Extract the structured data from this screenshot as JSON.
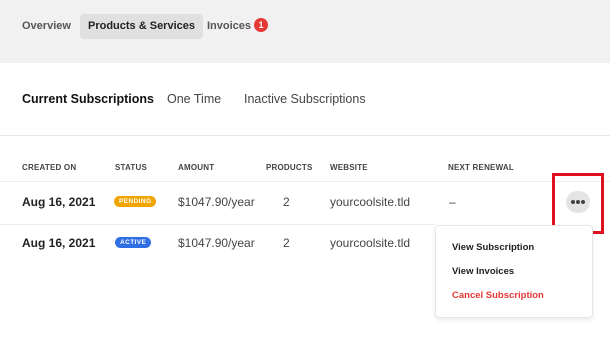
{
  "top_tabs": {
    "overview": "Overview",
    "products": "Products & Services",
    "invoices": "Invoices",
    "invoices_badge": "1"
  },
  "sub_tabs": {
    "current": "Current Subscriptions",
    "one_time": "One Time",
    "inactive": "Inactive Subscriptions"
  },
  "table": {
    "headers": {
      "created_on": "CREATED ON",
      "status": "STATUS",
      "amount": "AMOUNT",
      "products": "PRODUCTS",
      "website": "WEBSITE",
      "next_renewal": "NEXT RENEWAL"
    },
    "rows": [
      {
        "created_on": "Aug 16, 2021",
        "status": "PENDING",
        "status_color": "#f0a500",
        "amount": "$1047.90/year",
        "products": "2",
        "website": "yourcoolsite.tld",
        "next_renewal": "–"
      },
      {
        "created_on": "Aug 16, 2021",
        "status": "ACTIVE",
        "status_color": "#2f6fe4",
        "amount": "$1047.90/year",
        "products": "2",
        "website": "yourcoolsite.tld",
        "next_renewal": ""
      }
    ]
  },
  "row_actions": {
    "more_icon": "more-horizontal-icon",
    "menu": {
      "view_subscription": "View Subscription",
      "view_invoices": "View Invoices",
      "cancel_subscription": "Cancel Subscription"
    }
  },
  "colors": {
    "accent_red": "#e53935",
    "highlight": "#e0101e"
  }
}
